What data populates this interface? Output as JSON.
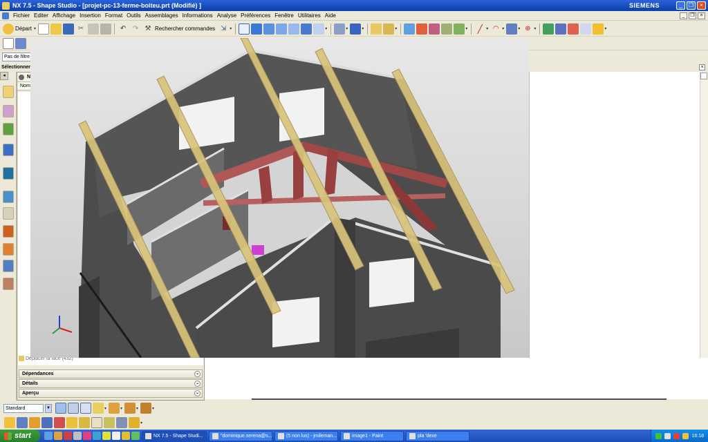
{
  "window": {
    "title": "NX 7.5 - Shape Studio - [projet-pc-13-ferme-boiteu.prt (Modifié) ]",
    "brand": "SIEMENS",
    "buttons": [
      "_",
      "❐",
      "×"
    ]
  },
  "menubar": {
    "items": [
      "Fichier",
      "Editer",
      "Affichage",
      "Insertion",
      "Format",
      "Outils",
      "Assemblages",
      "Informations",
      "Analyse",
      "Préférences",
      "Fenêtre",
      "Utilitaires",
      "Aide"
    ]
  },
  "toolbar": {
    "start_label": "Départ",
    "command_finder_label": "Rechercher commandes"
  },
  "filter": {
    "value": "Pas de filtre d"
  },
  "selection_bar": {
    "label": "Sélectionner"
  },
  "navigator": {
    "header_label": "Na",
    "column_name": "Nom",
    "bottom_item": "Déplacer la face (432)",
    "sections": [
      "Dépendances",
      "Détails",
      "Aperçu"
    ]
  },
  "bottom_toolbar": {
    "view_style": "Standard"
  },
  "taskbar": {
    "start_label": "start",
    "buttons": [
      {
        "label": "NX 7.5 - Shape Studi...",
        "active": true
      },
      {
        "label": "\"dominique.serena@s...",
        "active": false
      },
      {
        "label": "(5 non lus) - jmileman...",
        "active": false
      },
      {
        "label": "image1 - Paint",
        "active": false
      },
      {
        "label": "pla 'dexe",
        "active": false
      }
    ],
    "clock": "16:18"
  },
  "colors": {
    "accent": "#0b3fa8",
    "wall_gray": "#4a4a4a",
    "beam_tan": "#d8c47a",
    "truss_red": "#b05858",
    "highlight_magenta": "#d040d0"
  }
}
